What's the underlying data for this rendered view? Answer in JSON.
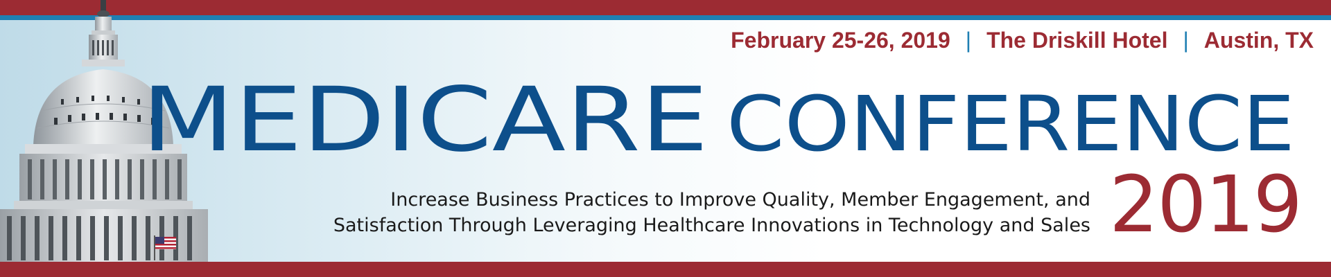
{
  "banner": {
    "event_info": {
      "dates": "February 25-26, 2019",
      "separator": "|",
      "venue": "The Driskill Hotel",
      "location": "Austin, TX"
    },
    "title_word_1": "MEDICARE",
    "title_word_2": "CONFERENCE",
    "year": "2019",
    "tagline_line_1": "Increase Business Practices to Improve Quality, Member Engagement, and",
    "tagline_line_2": "Satisfaction Through Leveraging Healthcare Innovations in Technology and Sales"
  },
  "colors": {
    "brand_red": "#9c2b33",
    "brand_blue": "#0d4f8b",
    "accent_blue": "#1f7fb3"
  },
  "icons": [
    "capitol-dome-illustration",
    "us-flag-icon"
  ]
}
